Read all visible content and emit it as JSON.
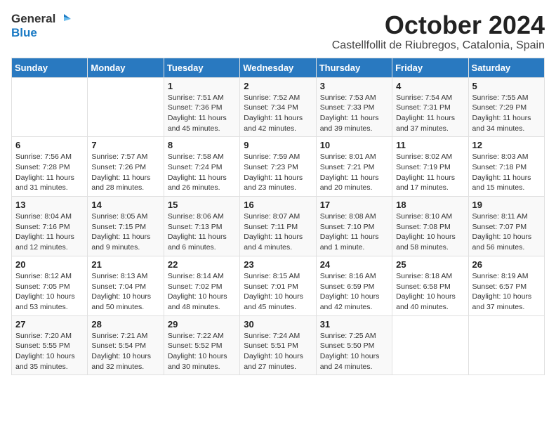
{
  "logo": {
    "general": "General",
    "blue": "Blue"
  },
  "title": "October 2024",
  "location": "Castellfollit de Riubregos, Catalonia, Spain",
  "days_of_week": [
    "Sunday",
    "Monday",
    "Tuesday",
    "Wednesday",
    "Thursday",
    "Friday",
    "Saturday"
  ],
  "weeks": [
    [
      {
        "day": "",
        "info": ""
      },
      {
        "day": "",
        "info": ""
      },
      {
        "day": "1",
        "info": "Sunrise: 7:51 AM\nSunset: 7:36 PM\nDaylight: 11 hours and 45 minutes."
      },
      {
        "day": "2",
        "info": "Sunrise: 7:52 AM\nSunset: 7:34 PM\nDaylight: 11 hours and 42 minutes."
      },
      {
        "day": "3",
        "info": "Sunrise: 7:53 AM\nSunset: 7:33 PM\nDaylight: 11 hours and 39 minutes."
      },
      {
        "day": "4",
        "info": "Sunrise: 7:54 AM\nSunset: 7:31 PM\nDaylight: 11 hours and 37 minutes."
      },
      {
        "day": "5",
        "info": "Sunrise: 7:55 AM\nSunset: 7:29 PM\nDaylight: 11 hours and 34 minutes."
      }
    ],
    [
      {
        "day": "6",
        "info": "Sunrise: 7:56 AM\nSunset: 7:28 PM\nDaylight: 11 hours and 31 minutes."
      },
      {
        "day": "7",
        "info": "Sunrise: 7:57 AM\nSunset: 7:26 PM\nDaylight: 11 hours and 28 minutes."
      },
      {
        "day": "8",
        "info": "Sunrise: 7:58 AM\nSunset: 7:24 PM\nDaylight: 11 hours and 26 minutes."
      },
      {
        "day": "9",
        "info": "Sunrise: 7:59 AM\nSunset: 7:23 PM\nDaylight: 11 hours and 23 minutes."
      },
      {
        "day": "10",
        "info": "Sunrise: 8:01 AM\nSunset: 7:21 PM\nDaylight: 11 hours and 20 minutes."
      },
      {
        "day": "11",
        "info": "Sunrise: 8:02 AM\nSunset: 7:19 PM\nDaylight: 11 hours and 17 minutes."
      },
      {
        "day": "12",
        "info": "Sunrise: 8:03 AM\nSunset: 7:18 PM\nDaylight: 11 hours and 15 minutes."
      }
    ],
    [
      {
        "day": "13",
        "info": "Sunrise: 8:04 AM\nSunset: 7:16 PM\nDaylight: 11 hours and 12 minutes."
      },
      {
        "day": "14",
        "info": "Sunrise: 8:05 AM\nSunset: 7:15 PM\nDaylight: 11 hours and 9 minutes."
      },
      {
        "day": "15",
        "info": "Sunrise: 8:06 AM\nSunset: 7:13 PM\nDaylight: 11 hours and 6 minutes."
      },
      {
        "day": "16",
        "info": "Sunrise: 8:07 AM\nSunset: 7:11 PM\nDaylight: 11 hours and 4 minutes."
      },
      {
        "day": "17",
        "info": "Sunrise: 8:08 AM\nSunset: 7:10 PM\nDaylight: 11 hours and 1 minute."
      },
      {
        "day": "18",
        "info": "Sunrise: 8:10 AM\nSunset: 7:08 PM\nDaylight: 10 hours and 58 minutes."
      },
      {
        "day": "19",
        "info": "Sunrise: 8:11 AM\nSunset: 7:07 PM\nDaylight: 10 hours and 56 minutes."
      }
    ],
    [
      {
        "day": "20",
        "info": "Sunrise: 8:12 AM\nSunset: 7:05 PM\nDaylight: 10 hours and 53 minutes."
      },
      {
        "day": "21",
        "info": "Sunrise: 8:13 AM\nSunset: 7:04 PM\nDaylight: 10 hours and 50 minutes."
      },
      {
        "day": "22",
        "info": "Sunrise: 8:14 AM\nSunset: 7:02 PM\nDaylight: 10 hours and 48 minutes."
      },
      {
        "day": "23",
        "info": "Sunrise: 8:15 AM\nSunset: 7:01 PM\nDaylight: 10 hours and 45 minutes."
      },
      {
        "day": "24",
        "info": "Sunrise: 8:16 AM\nSunset: 6:59 PM\nDaylight: 10 hours and 42 minutes."
      },
      {
        "day": "25",
        "info": "Sunrise: 8:18 AM\nSunset: 6:58 PM\nDaylight: 10 hours and 40 minutes."
      },
      {
        "day": "26",
        "info": "Sunrise: 8:19 AM\nSunset: 6:57 PM\nDaylight: 10 hours and 37 minutes."
      }
    ],
    [
      {
        "day": "27",
        "info": "Sunrise: 7:20 AM\nSunset: 5:55 PM\nDaylight: 10 hours and 35 minutes."
      },
      {
        "day": "28",
        "info": "Sunrise: 7:21 AM\nSunset: 5:54 PM\nDaylight: 10 hours and 32 minutes."
      },
      {
        "day": "29",
        "info": "Sunrise: 7:22 AM\nSunset: 5:52 PM\nDaylight: 10 hours and 30 minutes."
      },
      {
        "day": "30",
        "info": "Sunrise: 7:24 AM\nSunset: 5:51 PM\nDaylight: 10 hours and 27 minutes."
      },
      {
        "day": "31",
        "info": "Sunrise: 7:25 AM\nSunset: 5:50 PM\nDaylight: 10 hours and 24 minutes."
      },
      {
        "day": "",
        "info": ""
      },
      {
        "day": "",
        "info": ""
      }
    ]
  ]
}
